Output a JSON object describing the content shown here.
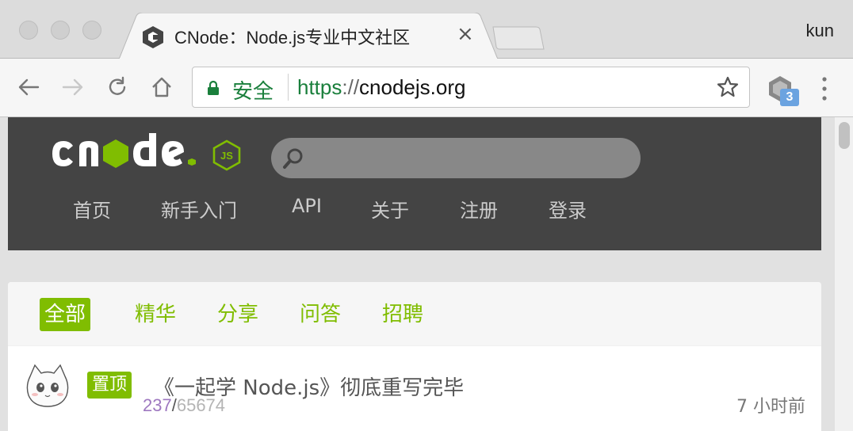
{
  "browser": {
    "tab_title": "CNode：Node.js专业中文社区",
    "profile_name": "kun",
    "url_scheme": "https",
    "url_separator": "://",
    "url_host": "cnodejs.org",
    "security_label": "安全",
    "extension_badge": "3"
  },
  "header": {
    "search_placeholder": "",
    "nav": [
      "首页",
      "新手入门",
      "API",
      "关于",
      "注册",
      "登录"
    ]
  },
  "topic_tabs": {
    "items": [
      "全部",
      "精华",
      "分享",
      "问答",
      "招聘"
    ],
    "active": "全部"
  },
  "topics": [
    {
      "pinned_label": "置顶",
      "title": "《一起学 Node.js》彻底重写完毕",
      "reply_count": "237",
      "count_separator": "/",
      "visit_count": "65674",
      "last_reply": "7 小时前"
    }
  ],
  "colors": {
    "accent": "#80bd01",
    "header_bg": "#444444",
    "secure_green": "#1a7f3c"
  }
}
